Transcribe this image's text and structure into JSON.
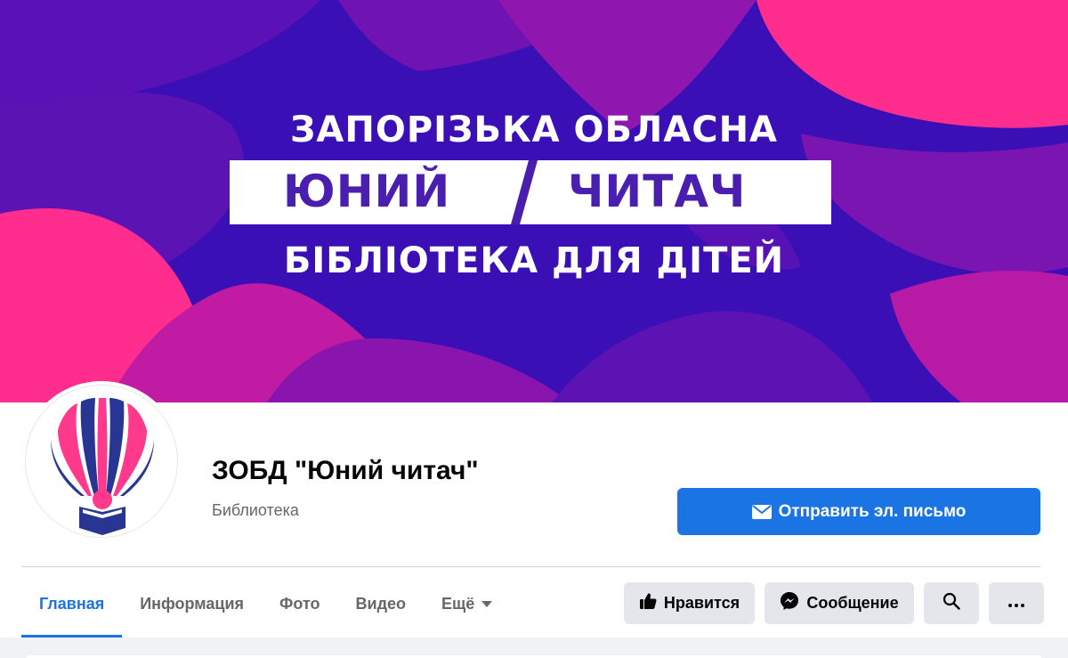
{
  "cover": {
    "line1": "ЗАПОРІЗЬКА ОБЛАСНА",
    "word_left": "ЮНИЙ",
    "word_right": "ЧИТАЧ",
    "line3": "БІБЛІОТЕКА ДЛЯ ДІТЕЙ",
    "colors": {
      "purple": "#3a0fb5",
      "pink": "#ff2d8e",
      "violet": "#6a14b8",
      "ribbon_text": "#4a1fb0"
    }
  },
  "page": {
    "name": "ЗОБД \"Юний читач\"",
    "category": "Библиотека"
  },
  "email_button": {
    "label": "Отправить эл. письмо",
    "icon": "envelope-icon"
  },
  "tabs": [
    {
      "label": "Главная",
      "active": true
    },
    {
      "label": "Информация",
      "active": false
    },
    {
      "label": "Фото",
      "active": false
    },
    {
      "label": "Видео",
      "active": false
    },
    {
      "label": "Ещё",
      "active": false
    }
  ],
  "actions": {
    "like_label": "Нравится",
    "message_label": "Сообщение",
    "search_icon": "search-icon",
    "more_icon": "more-icon"
  },
  "accent": "#1b74e4"
}
